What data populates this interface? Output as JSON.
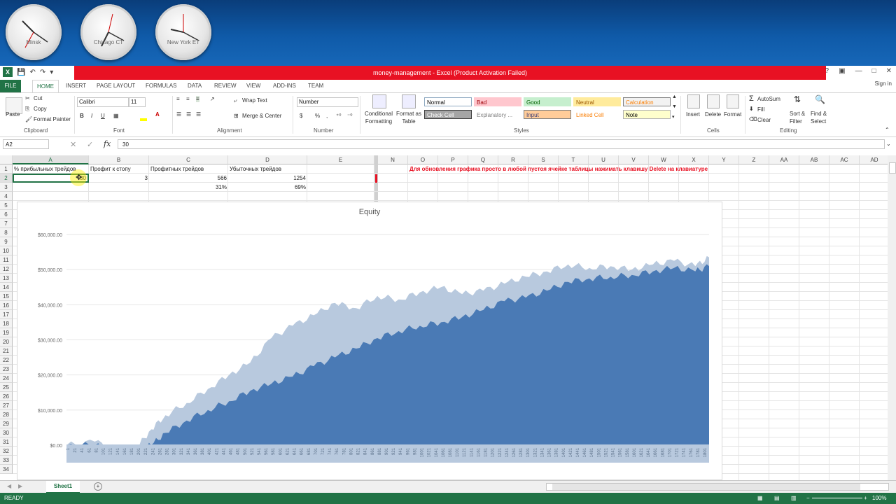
{
  "desktop": {
    "clocks": [
      {
        "city": "Minsk"
      },
      {
        "city": "Chicago CT"
      },
      {
        "city": "New York ET"
      }
    ]
  },
  "window": {
    "title": "money-management - Excel (Product Activation Failed)",
    "controls": [
      "?",
      "▣",
      "—",
      "□",
      "✕"
    ]
  },
  "ribbon_tabs": {
    "file": "FILE",
    "tabs": [
      "HOME",
      "INSERT",
      "PAGE LAYOUT",
      "FORMULAS",
      "DATA",
      "REVIEW",
      "VIEW",
      "ADD-INS",
      "TEAM"
    ],
    "active": "HOME",
    "sign_in": "Sign in"
  },
  "ribbon": {
    "clipboard": {
      "paste": "Paste",
      "cut": "Cut",
      "copy": "Copy",
      "format_painter": "Format Painter",
      "label": "Clipboard"
    },
    "font": {
      "name": "Calibri",
      "size": "11",
      "bold": "B",
      "italic": "I",
      "underline": "U",
      "label": "Font"
    },
    "alignment": {
      "wrap": "Wrap Text",
      "merge": "Merge & Center",
      "label": "Alignment"
    },
    "number": {
      "format": "Number",
      "currency": "$",
      "percent": "%",
      "comma": ",",
      "label": "Number"
    },
    "styles": {
      "conditional": "Conditional Formatting",
      "format_table": "Format as Table",
      "cells": [
        {
          "text": "Normal",
          "bg": "#ffffff",
          "fg": "#000000",
          "border": "#8ea9c1"
        },
        {
          "text": "Bad",
          "bg": "#ffc7ce",
          "fg": "#9c0006",
          "border": "#ffc7ce"
        },
        {
          "text": "Good",
          "bg": "#c6efce",
          "fg": "#006100",
          "border": "#c6efce"
        },
        {
          "text": "Neutral",
          "bg": "#ffeb9c",
          "fg": "#9c5700",
          "border": "#ffeb9c"
        },
        {
          "text": "Calculation",
          "bg": "#f2f2f2",
          "fg": "#fa7d00",
          "border": "#7f7f7f"
        },
        {
          "text": "Check Cell",
          "bg": "#a5a5a5",
          "fg": "#ffffff",
          "border": "#3f3f3f"
        },
        {
          "text": "Explanatory ...",
          "bg": "#ffffff",
          "fg": "#7f7f7f",
          "border": "#ffffff"
        },
        {
          "text": "Input",
          "bg": "#ffcc99",
          "fg": "#3f3f76",
          "border": "#7f7f7f"
        },
        {
          "text": "Linked Cell",
          "bg": "#ffffff",
          "fg": "#fa7d00",
          "border": "#ffffff"
        },
        {
          "text": "Note",
          "bg": "#ffffcc",
          "fg": "#000000",
          "border": "#b2b2b2"
        }
      ],
      "label": "Styles"
    },
    "cells_group": {
      "insert": "Insert",
      "delete": "Delete",
      "format": "Format",
      "label": "Cells"
    },
    "editing": {
      "autosum": "AutoSum",
      "fill": "Fill",
      "clear": "Clear",
      "sort": "Sort & Filter",
      "find": "Find & Select",
      "label": "Editing"
    }
  },
  "formula_bar": {
    "name_box": "A2",
    "fx": "fx",
    "value": "30"
  },
  "columns_left": [
    {
      "name": "A",
      "width": 109
    },
    {
      "name": "B",
      "width": 86
    },
    {
      "name": "C",
      "width": 113
    },
    {
      "name": "D",
      "width": 113
    },
    {
      "name": "E",
      "width": 96
    }
  ],
  "columns_right": [
    "N",
    "O",
    "P",
    "Q",
    "R",
    "S",
    "T",
    "U",
    "V",
    "W",
    "X",
    "Y",
    "Z",
    "AA",
    "AB",
    "AC",
    "AD"
  ],
  "rows": [
    "1",
    "2",
    "3",
    "4",
    "5",
    "6",
    "7",
    "8",
    "9",
    "10",
    "11",
    "12",
    "13",
    "14",
    "15",
    "16",
    "17",
    "18",
    "19",
    "20",
    "21",
    "22",
    "23",
    "24",
    "25",
    "26",
    "27",
    "28",
    "29",
    "30",
    "31",
    "32",
    "33",
    "34"
  ],
  "cells": {
    "A1": "% прибыльных трейдов",
    "B1": "Профит к стопу",
    "C1": "Профитных трейдов",
    "D1": "Убыточных трейдов",
    "A2": "30",
    "B2": "3",
    "C2": "566",
    "D2": "1254",
    "C3": "31%",
    "D3": "69%",
    "note": "Для обновления графика просто в любой пустоя ячейке таблицы нажимать клавишу Delete на клавиатуре"
  },
  "chart_data": {
    "type": "area",
    "title": "Equity",
    "ylim": [
      -5000,
      62000
    ],
    "y_ticks": [
      "$60,000.00",
      "$50,000.00",
      "$40,000.00",
      "$30,000.00",
      "$20,000.00",
      "$10,000.00",
      "$0.00"
    ],
    "x_tick_labels": [
      "1",
      "21",
      "41",
      "61",
      "81",
      "101",
      "121",
      "141",
      "161",
      "181",
      "201",
      "221",
      "241",
      "261",
      "281",
      "301",
      "321",
      "341",
      "361",
      "381",
      "401",
      "421",
      "441",
      "461",
      "481",
      "501",
      "521",
      "541",
      "561",
      "581",
      "601",
      "621",
      "641",
      "661",
      "681",
      "701",
      "721",
      "741",
      "761",
      "781",
      "801",
      "821",
      "841",
      "861",
      "881",
      "901",
      "921",
      "941",
      "961",
      "981",
      "1001",
      "1021",
      "1041",
      "1061",
      "1081",
      "1101",
      "1121",
      "1141",
      "1161",
      "1181",
      "1201",
      "1221",
      "1241",
      "1261",
      "1281",
      "1301",
      "1321",
      "1341",
      "1361",
      "1381",
      "1401",
      "1421",
      "1441",
      "1461",
      "1481",
      "1501",
      "1521",
      "1541",
      "1561",
      "1581",
      "1601",
      "1621",
      "1641",
      "1661",
      "1681",
      "1701",
      "1721",
      "1741",
      "1761",
      "1781",
      "1801"
    ],
    "x": [
      1,
      81,
      141,
      201,
      241,
      281,
      341,
      401,
      461,
      521,
      581,
      641,
      701,
      761,
      821,
      881,
      941,
      1001,
      1061,
      1121,
      1181,
      1241,
      1301,
      1361,
      1421,
      1481,
      1541,
      1601,
      1661,
      1721,
      1781,
      1820
    ],
    "series": [
      {
        "values": [
          0,
          1000,
          -1000,
          -500,
          4500,
          8500,
          12000,
          16000,
          20000,
          23500,
          30500,
          34000,
          37000,
          40500,
          39000,
          42500,
          41500,
          43500,
          45000,
          43000,
          44000,
          46000,
          48000,
          49500,
          51500,
          50500,
          51000,
          50000,
          51500,
          52500,
          51000,
          53500
        ],
        "color": "#b8c9de"
      },
      {
        "values": [
          0,
          0,
          -1500,
          -1000,
          0,
          3500,
          7000,
          10000,
          12500,
          15500,
          17500,
          19500,
          22500,
          25000,
          27500,
          30500,
          32500,
          34000,
          35000,
          36500,
          38500,
          41000,
          42000,
          44000,
          46500,
          47500,
          48000,
          48500,
          49500,
          50500,
          49500,
          51000
        ],
        "color": "#4a7ab5"
      }
    ]
  },
  "sheets": {
    "active": "Sheet1",
    "add": "+"
  },
  "status": {
    "text": "READY",
    "zoom": "100%"
  }
}
